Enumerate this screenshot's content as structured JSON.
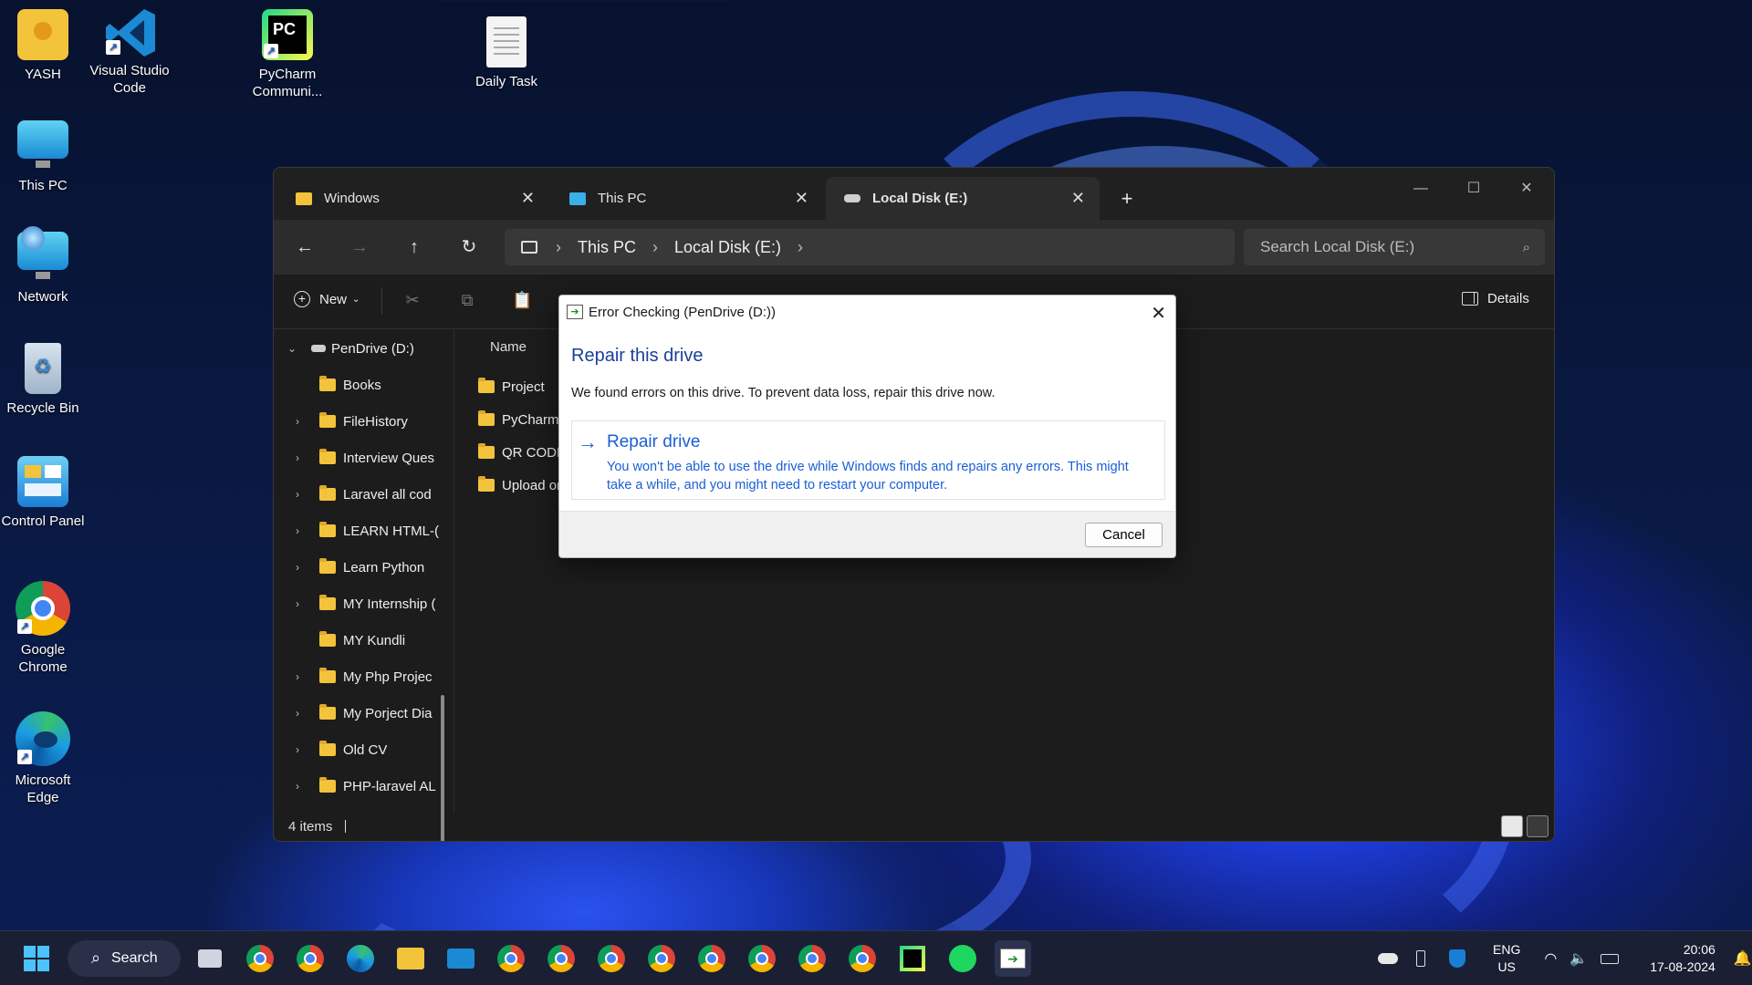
{
  "desktop": {
    "icons": [
      {
        "label": "YASH",
        "icon": "user-folder-icon"
      },
      {
        "label": "Visual Studio Code",
        "icon": "vscode-icon"
      },
      {
        "label": "PyCharm Communi...",
        "icon": "pycharm-icon"
      },
      {
        "label": "Daily Task",
        "icon": "text-file-icon"
      },
      {
        "label": "This PC",
        "icon": "monitor-icon"
      },
      {
        "label": "Network",
        "icon": "network-icon"
      },
      {
        "label": "Recycle Bin",
        "icon": "recycle-bin-icon"
      },
      {
        "label": "Control Panel",
        "icon": "control-panel-icon"
      },
      {
        "label": "Google Chrome",
        "icon": "chrome-icon"
      },
      {
        "label": "Microsoft Edge",
        "icon": "edge-icon"
      }
    ]
  },
  "explorer": {
    "tabs": [
      {
        "label": "Windows",
        "icon": "folder-icon"
      },
      {
        "label": "This PC",
        "icon": "monitor-icon"
      },
      {
        "label": "Local Disk (E:)",
        "icon": "drive-icon"
      }
    ],
    "new_tab": "+",
    "breadcrumb": [
      "This PC",
      "Local Disk (E:)"
    ],
    "search_placeholder": "Search Local Disk (E:)",
    "cmd": {
      "new_label": "New",
      "details_label": "Details"
    },
    "tree_root": "PenDrive (D:)",
    "tree": [
      {
        "label": "Books",
        "expandable": false
      },
      {
        "label": "FileHistory",
        "expandable": true
      },
      {
        "label": "Interview Ques",
        "expandable": true
      },
      {
        "label": "Laravel all cod",
        "expandable": true
      },
      {
        "label": "LEARN HTML-(",
        "expandable": true
      },
      {
        "label": "Learn Python",
        "expandable": true
      },
      {
        "label": "MY Internship (",
        "expandable": true
      },
      {
        "label": "MY Kundli",
        "expandable": false
      },
      {
        "label": "My Php Projec",
        "expandable": true
      },
      {
        "label": "My Porject Dia",
        "expandable": true
      },
      {
        "label": "Old CV",
        "expandable": true
      },
      {
        "label": "PHP-laravel AL",
        "expandable": true
      }
    ],
    "column_name": "Name",
    "files": [
      "Project",
      "PyCharm (",
      "QR CODE",
      "Upload or"
    ],
    "status": "4 items"
  },
  "dialog": {
    "title": "Error Checking (PenDrive (D:))",
    "heading": "Repair this drive",
    "text": "We found errors on this drive. To prevent data loss, repair this drive now.",
    "option_title": "Repair drive",
    "option_desc": "You won't be able to use the drive while Windows finds and repairs any errors. This might take a while, and you might need to restart your computer.",
    "cancel": "Cancel"
  },
  "taskbar": {
    "search_label": "Search",
    "lang": "ENG",
    "region": "US",
    "time": "20:06",
    "date": "17-08-2024"
  }
}
